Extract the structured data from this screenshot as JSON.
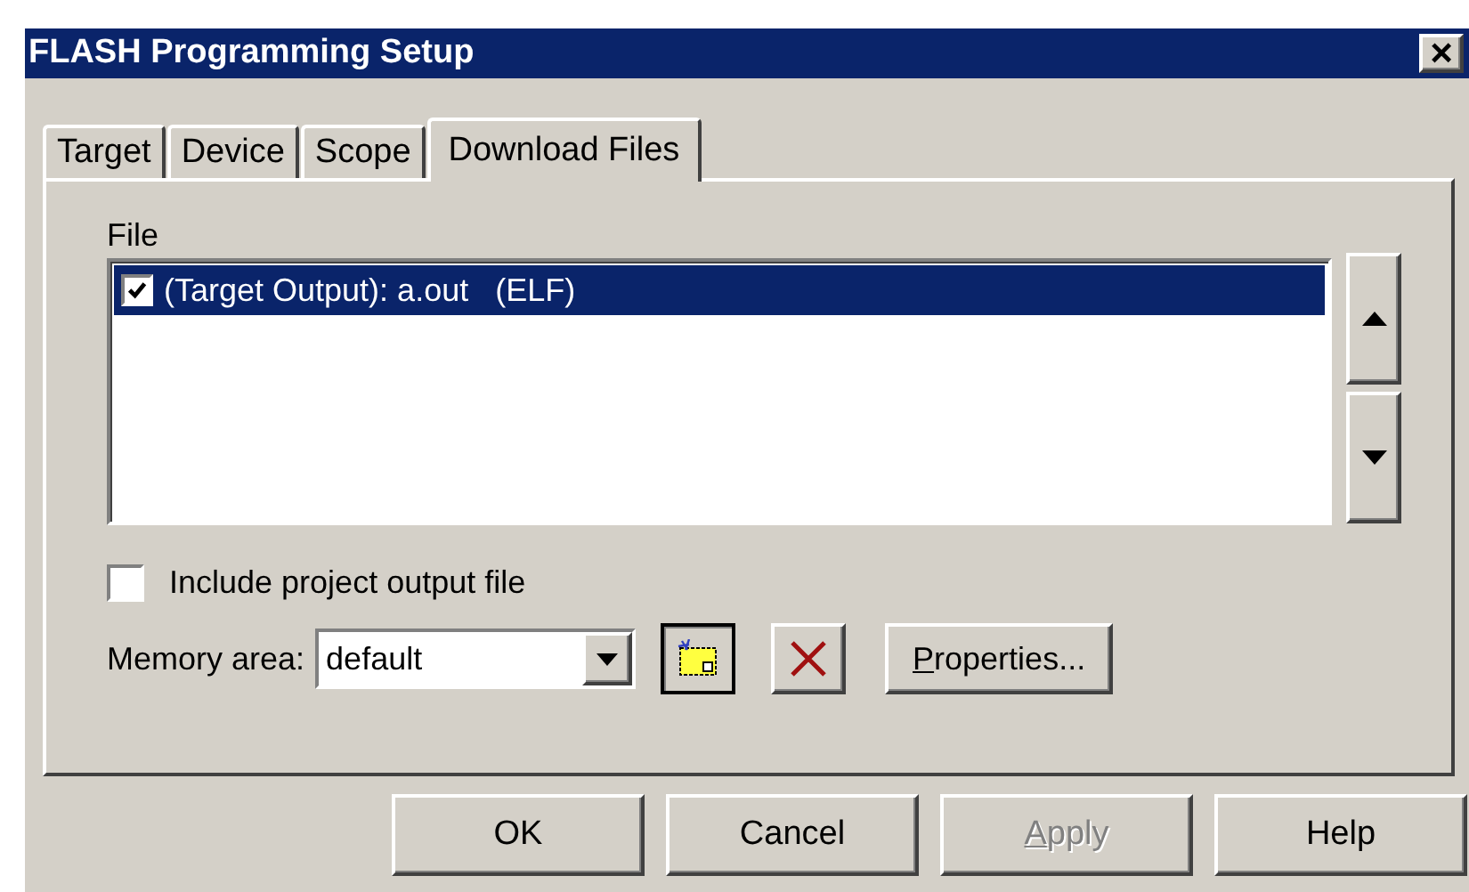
{
  "window": {
    "title": "FLASH Programming Setup",
    "close": "×"
  },
  "tabs": [
    {
      "label": "Target",
      "selected": false
    },
    {
      "label": "Device",
      "selected": false
    },
    {
      "label": "Scope",
      "selected": false
    },
    {
      "label": "Download Files",
      "selected": true
    }
  ],
  "file_list": {
    "label": "File",
    "items": [
      {
        "text": "(Target Output): a.out   (ELF)",
        "checked": true,
        "selected": true
      }
    ]
  },
  "include_project_output": {
    "label": "Include project output file",
    "checked": false
  },
  "memory_area": {
    "label": "Memory area:",
    "value": "default"
  },
  "properties_button": {
    "label": "Properties...",
    "mnemonic_first": true
  },
  "buttons": [
    {
      "label": "OK",
      "disabled": false,
      "mnemonic_first": false
    },
    {
      "label": "Cancel",
      "disabled": false,
      "mnemonic_first": false
    },
    {
      "label": "Apply",
      "disabled": true,
      "mnemonic_first": true
    },
    {
      "label": "Help",
      "disabled": false,
      "mnemonic_first": false
    }
  ]
}
